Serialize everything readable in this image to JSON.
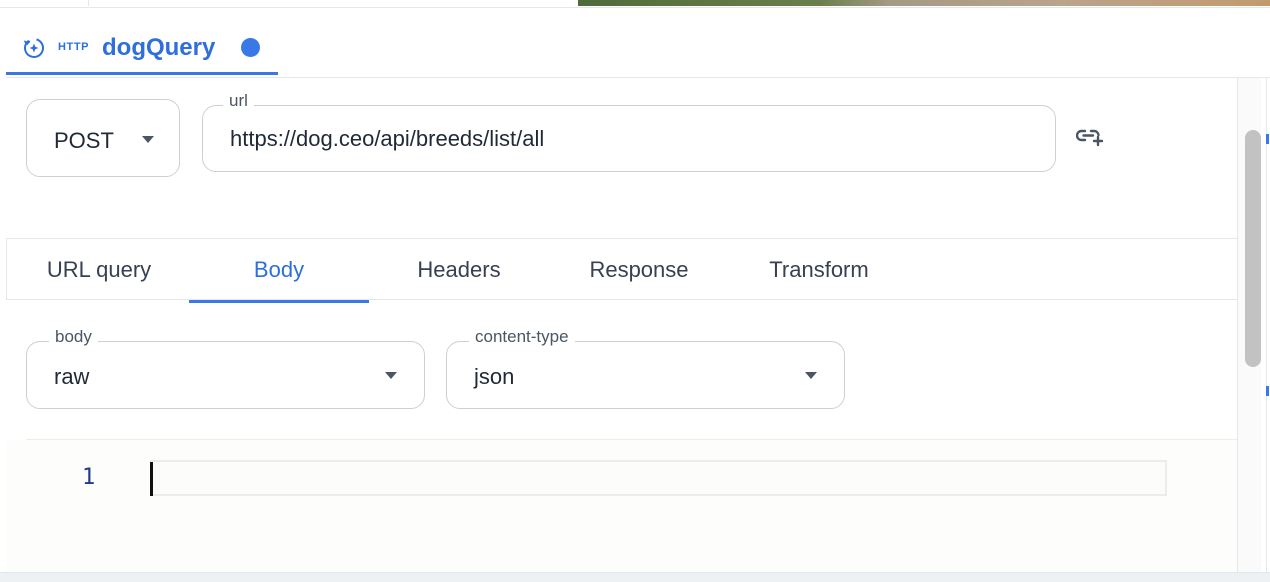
{
  "query_tab": {
    "protocol": "HTTP",
    "name": "dogQuery",
    "accent_color": "#2e6fdc",
    "unsaved_dot_color": "#3a78e8",
    "icon": "query-refresh-icon"
  },
  "request": {
    "method": "POST",
    "url_label": "url",
    "url_value": "https://dog.ceo/api/breeds/list/all",
    "add_param_icon": "link-add-icon"
  },
  "subtabs": [
    {
      "label": "URL query",
      "active": false
    },
    {
      "label": "Body",
      "active": true
    },
    {
      "label": "Headers",
      "active": false
    },
    {
      "label": "Response",
      "active": false
    },
    {
      "label": "Transform",
      "active": false
    }
  ],
  "body_settings": {
    "body_label": "body",
    "body_value": "raw",
    "content_type_label": "content-type",
    "content_type_value": "json"
  },
  "editor": {
    "line_numbers": [
      "1"
    ],
    "lines": [
      ""
    ]
  }
}
